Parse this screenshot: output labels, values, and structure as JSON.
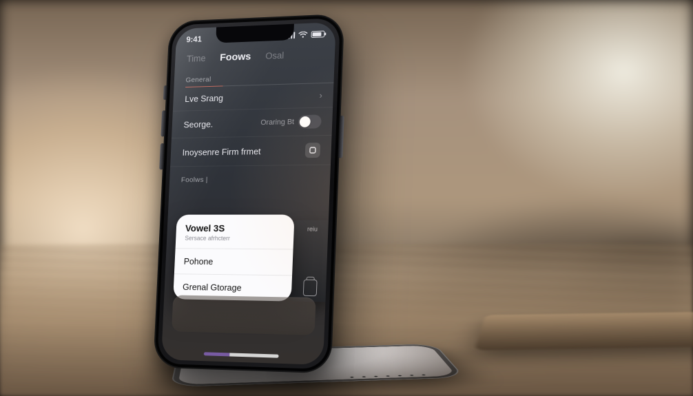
{
  "status_bar": {
    "time": "9:41"
  },
  "tabs": {
    "left": "Time",
    "center": "Foows",
    "right": "Osal"
  },
  "section1_title": "General",
  "accent_hairline": "#e2674f",
  "rows": [
    {
      "label": "Lve Srang"
    },
    {
      "label": "Seorge.",
      "value": "Oraring Bt"
    },
    {
      "label": "Inoysenre Firm frmet"
    }
  ],
  "section2_title": "Foolws |",
  "popover": {
    "title": "Vowel 3S",
    "subtitle": "Sersace afrhcterr",
    "items": [
      "Pohone",
      "Grenal Gtorage"
    ]
  },
  "peek_label": "reiu"
}
